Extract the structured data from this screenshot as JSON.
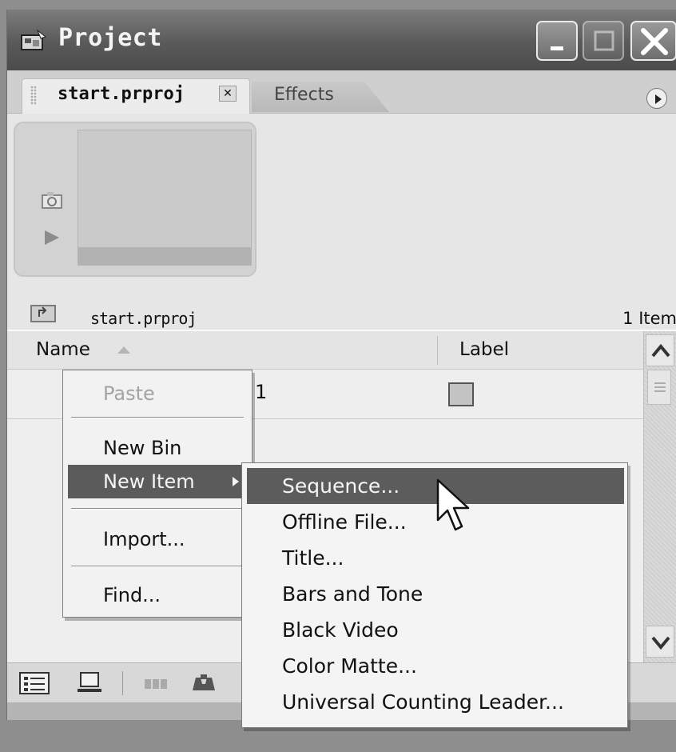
{
  "window": {
    "title": "Project"
  },
  "tabs": [
    {
      "label": "start.prproj",
      "active": true
    },
    {
      "label": "Effects",
      "active": false
    }
  ],
  "preview": {
    "bin_name": "start.prproj",
    "item_count": "1 Item"
  },
  "list": {
    "columns": [
      "Name",
      "Label"
    ],
    "rows": [
      {
        "name_visible": "1",
        "label_color": "#c4c4c4"
      }
    ]
  },
  "context_menu": {
    "items": [
      "Paste",
      "New Bin",
      "New Item",
      "Import...",
      "Find..."
    ]
  },
  "submenu": {
    "items": [
      "Sequence...",
      "Offline File...",
      "Title...",
      "Bars and Tone",
      "Black Video",
      "Color Matte...",
      "Universal Counting Leader..."
    ]
  },
  "icons": {
    "app": "project-app-icon",
    "poster": "poster-frame-icon",
    "play": "play-icon",
    "up": "parent-bin-icon",
    "list_view": "list-view-icon",
    "icon_view": "icon-view-icon",
    "automate": "automate-to-sequence-icon",
    "find": "find-icon"
  },
  "colors": {
    "highlight": "#5b5b5b",
    "titlebar": "#5a5a5a"
  }
}
